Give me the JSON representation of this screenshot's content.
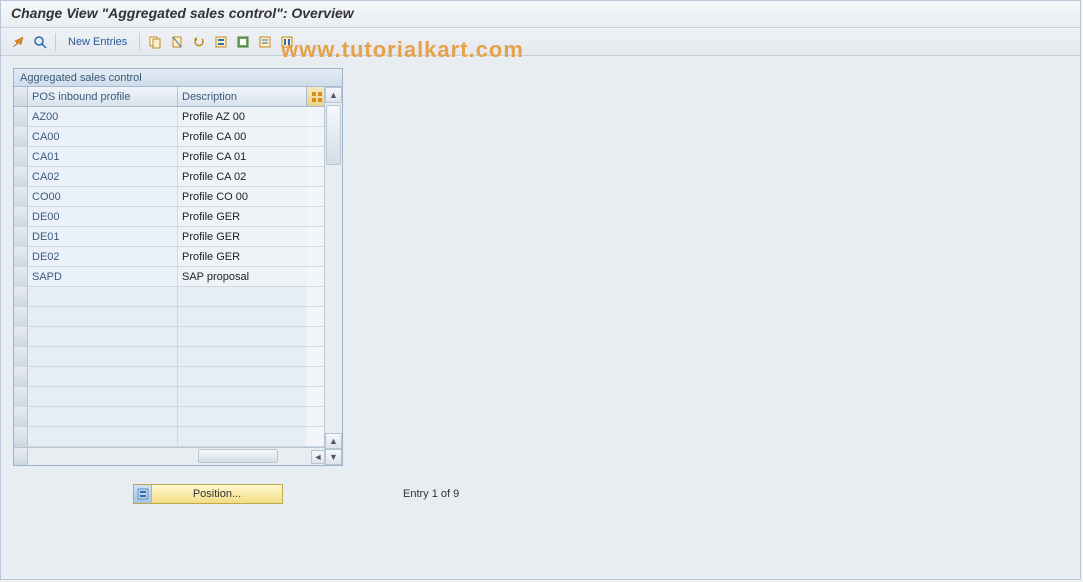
{
  "title": "Change View \"Aggregated sales control\": Overview",
  "toolbar": {
    "new_entries": "New Entries"
  },
  "watermark": "www.tutorialkart.com",
  "panel": {
    "title": "Aggregated sales control",
    "col1": "POS inbound profile",
    "col2": "Description"
  },
  "rows": [
    {
      "profile": "AZ00",
      "desc": "Profile AZ 00"
    },
    {
      "profile": "CA00",
      "desc": "Profile CA 00"
    },
    {
      "profile": "CA01",
      "desc": "Profile CA 01"
    },
    {
      "profile": "CA02",
      "desc": "Profile CA 02"
    },
    {
      "profile": "CO00",
      "desc": "Profile CO 00"
    },
    {
      "profile": "DE00",
      "desc": "Profile GER"
    },
    {
      "profile": "DE01",
      "desc": "Profile GER"
    },
    {
      "profile": "DE02",
      "desc": "Profile GER"
    },
    {
      "profile": "SAPD",
      "desc": "SAP proposal"
    }
  ],
  "empty_rows": 8,
  "footer": {
    "position_label": "Position...",
    "entry_text": "Entry 1 of 9"
  }
}
